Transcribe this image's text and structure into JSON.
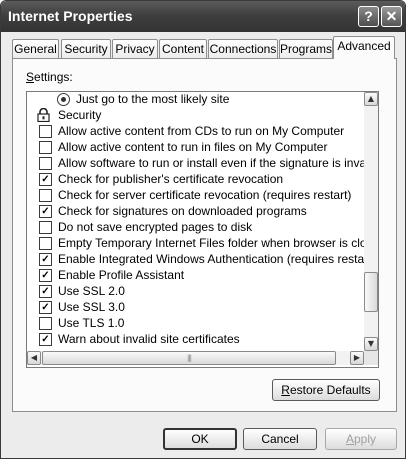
{
  "window": {
    "title": "Internet Properties"
  },
  "titlebar": {
    "help_glyph": "?",
    "close_glyph": "✕"
  },
  "tabs": [
    {
      "label": "General"
    },
    {
      "label": "Security"
    },
    {
      "label": "Privacy"
    },
    {
      "label": "Content"
    },
    {
      "label": "Connections"
    },
    {
      "label": "Programs"
    },
    {
      "label": "Advanced",
      "selected": true
    }
  ],
  "settings": {
    "label": "Settings:",
    "rows": [
      {
        "kind": "radio",
        "label": "Just go to the most likely site",
        "checked": true
      },
      {
        "kind": "group",
        "label": "Security",
        "icon": "lock-icon"
      },
      {
        "kind": "check",
        "label": "Allow active content from CDs to run on My Computer",
        "checked": false
      },
      {
        "kind": "check",
        "label": "Allow active content to run in files on My Computer",
        "checked": false
      },
      {
        "kind": "check",
        "label": "Allow software to run or install even if the signature is invalid",
        "checked": false
      },
      {
        "kind": "check",
        "label": "Check for publisher's certificate revocation",
        "checked": true
      },
      {
        "kind": "check",
        "label": "Check for server certificate revocation (requires restart)",
        "checked": false
      },
      {
        "kind": "check",
        "label": "Check for signatures on downloaded programs",
        "checked": true
      },
      {
        "kind": "check",
        "label": "Do not save encrypted pages to disk",
        "checked": false
      },
      {
        "kind": "check",
        "label": "Empty Temporary Internet Files folder when browser is closed",
        "checked": false
      },
      {
        "kind": "check",
        "label": "Enable Integrated Windows Authentication (requires restart)",
        "checked": true
      },
      {
        "kind": "check",
        "label": "Enable Profile Assistant",
        "checked": true
      },
      {
        "kind": "check",
        "label": "Use SSL 2.0",
        "checked": true
      },
      {
        "kind": "check",
        "label": "Use SSL 3.0",
        "checked": true
      },
      {
        "kind": "check",
        "label": "Use TLS 1.0",
        "checked": false
      },
      {
        "kind": "check",
        "label": "Warn about invalid site certificates",
        "checked": true
      }
    ],
    "check_glyph": "✓"
  },
  "buttons": {
    "restore_defaults": "Restore Defaults",
    "ok": "OK",
    "cancel": "Cancel",
    "apply": "Apply"
  },
  "colors": {
    "titlebar": "#3f3f3f",
    "window_bg": "#ececec"
  }
}
